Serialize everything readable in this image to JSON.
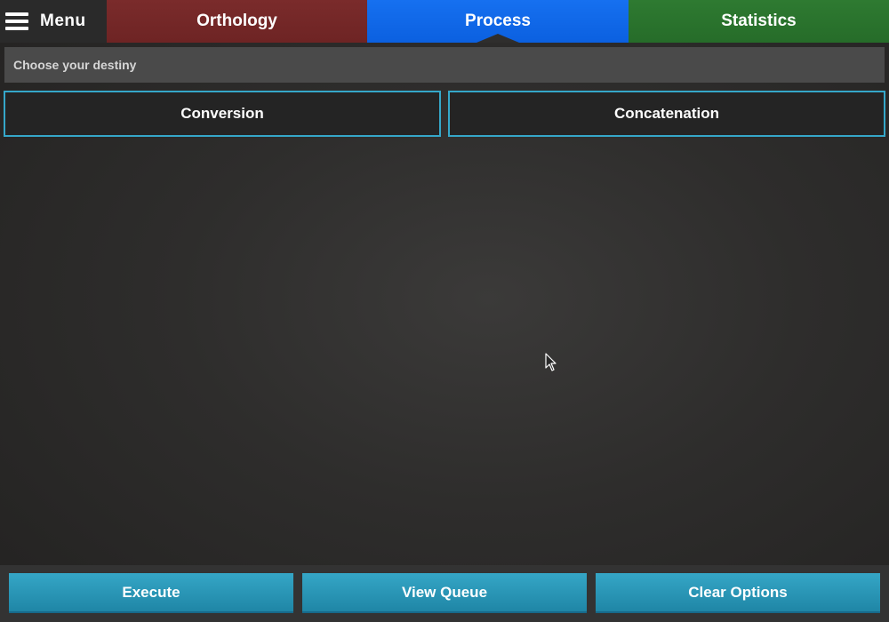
{
  "menu": {
    "label": "Menu",
    "icon": "hamburger-icon"
  },
  "tabs": [
    {
      "label": "Orthology",
      "color": "#742828"
    },
    {
      "label": "Process",
      "color": "#1068e8",
      "active": true
    },
    {
      "label": "Statistics",
      "color": "#2a732d"
    }
  ],
  "subtitle": "Choose your destiny",
  "options": [
    {
      "label": "Conversion"
    },
    {
      "label": "Concatenation"
    }
  ],
  "actions": [
    {
      "label": "Execute"
    },
    {
      "label": "View Queue"
    },
    {
      "label": "Clear Options"
    }
  ],
  "colors": {
    "accent": "#35a7c9",
    "background": "#2e2d2c"
  }
}
